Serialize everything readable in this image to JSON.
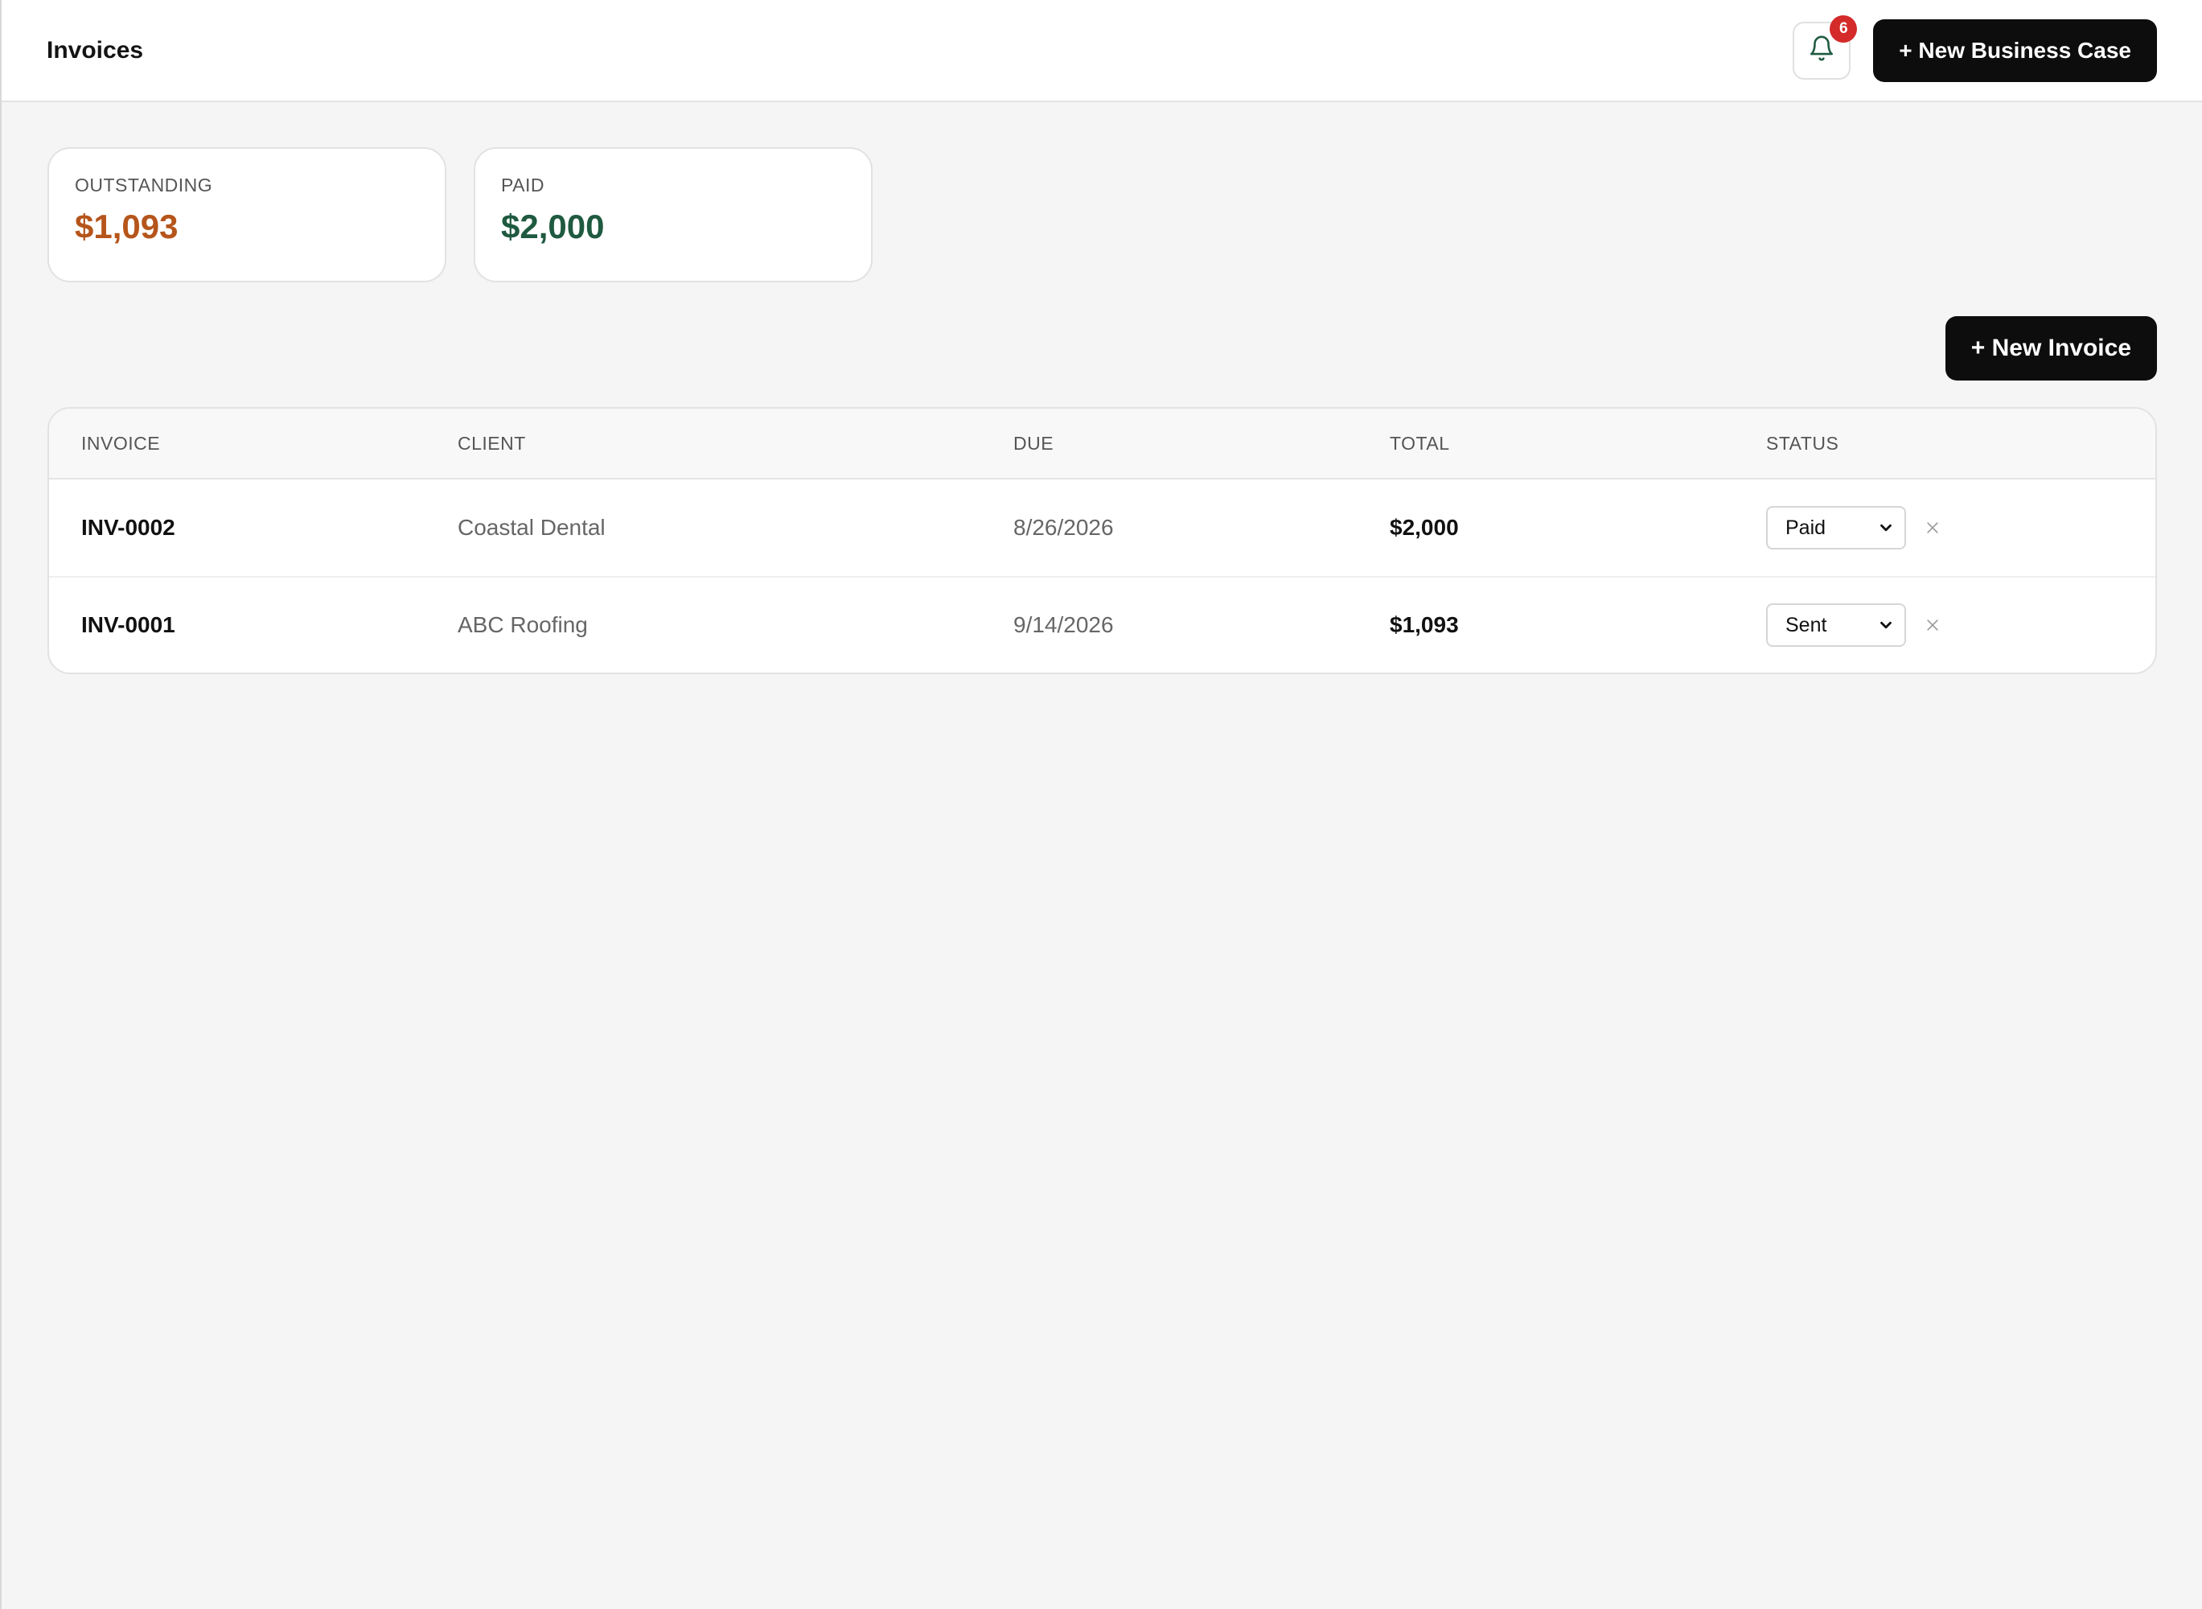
{
  "header": {
    "title": "Invoices",
    "notification_count": "6",
    "new_business_case_label": "+ New Business Case"
  },
  "stats": {
    "outstanding": {
      "label": "OUTSTANDING",
      "value": "$1,093",
      "color": "#b5551b"
    },
    "paid": {
      "label": "PAID",
      "value": "$2,000",
      "color": "#1f5a40"
    }
  },
  "actions": {
    "new_invoice_label": "+ New Invoice"
  },
  "table": {
    "columns": [
      "INVOICE",
      "CLIENT",
      "DUE",
      "TOTAL",
      "STATUS"
    ],
    "rows": [
      {
        "invoice": "INV-0002",
        "client": "Coastal Dental",
        "due": "8/26/2026",
        "total": "$2,000",
        "status": "Paid"
      },
      {
        "invoice": "INV-0001",
        "client": "ABC Roofing",
        "due": "9/14/2026",
        "total": "$1,093",
        "status": "Sent"
      }
    ]
  }
}
